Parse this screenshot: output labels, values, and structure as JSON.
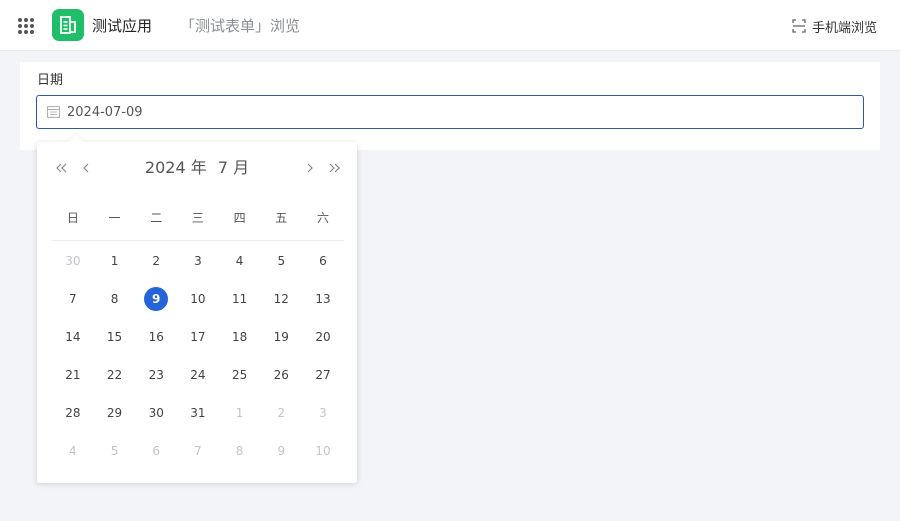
{
  "header": {
    "app_name": "测试应用",
    "form_title": "「测试表单」浏览",
    "mobile_preview_label": "手机端浏览"
  },
  "form": {
    "field_label": "日期",
    "date_value": "2024-07-09"
  },
  "calendar": {
    "year": "2024 年",
    "month": "7 月",
    "weekdays": [
      "日",
      "一",
      "二",
      "三",
      "四",
      "五",
      "六"
    ],
    "weeks": [
      [
        {
          "d": "30",
          "o": true
        },
        {
          "d": "1"
        },
        {
          "d": "2"
        },
        {
          "d": "3"
        },
        {
          "d": "4"
        },
        {
          "d": "5"
        },
        {
          "d": "6"
        }
      ],
      [
        {
          "d": "7"
        },
        {
          "d": "8"
        },
        {
          "d": "9",
          "s": true
        },
        {
          "d": "10"
        },
        {
          "d": "11"
        },
        {
          "d": "12"
        },
        {
          "d": "13"
        }
      ],
      [
        {
          "d": "14"
        },
        {
          "d": "15"
        },
        {
          "d": "16"
        },
        {
          "d": "17"
        },
        {
          "d": "18"
        },
        {
          "d": "19"
        },
        {
          "d": "20"
        }
      ],
      [
        {
          "d": "21"
        },
        {
          "d": "22"
        },
        {
          "d": "23"
        },
        {
          "d": "24"
        },
        {
          "d": "25"
        },
        {
          "d": "26"
        },
        {
          "d": "27"
        }
      ],
      [
        {
          "d": "28"
        },
        {
          "d": "29"
        },
        {
          "d": "30"
        },
        {
          "d": "31"
        },
        {
          "d": "1",
          "o": true
        },
        {
          "d": "2",
          "o": true
        },
        {
          "d": "3",
          "o": true
        }
      ],
      [
        {
          "d": "4",
          "o": true
        },
        {
          "d": "5",
          "o": true
        },
        {
          "d": "6",
          "o": true
        },
        {
          "d": "7",
          "o": true
        },
        {
          "d": "8",
          "o": true
        },
        {
          "d": "9",
          "o": true
        },
        {
          "d": "10",
          "o": true
        }
      ]
    ]
  },
  "icons": {
    "apps": "grid-dots-icon",
    "logo": "form-sheet-icon",
    "mobile": "scan-frame-icon",
    "input": "calendar-icon"
  },
  "colors": {
    "logo_bg": "#1fbf6a",
    "selected_day": "#2563d8",
    "input_border": "#2c5aa8"
  }
}
